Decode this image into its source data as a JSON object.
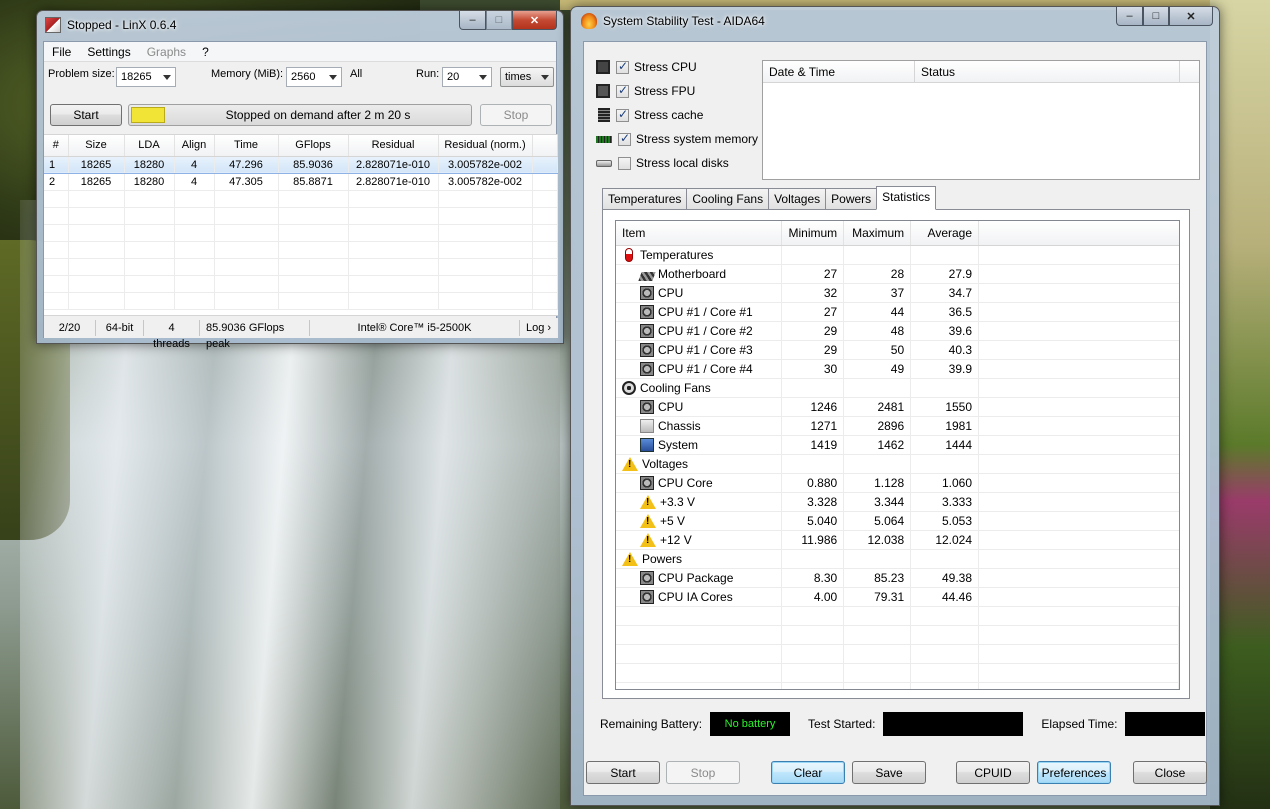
{
  "linx": {
    "title": "Stopped - LinX 0.6.4",
    "menu": [
      "File",
      "Settings",
      "Graphs",
      "?"
    ],
    "problem_size_label": "Problem size:",
    "problem_size_value": "18265",
    "memory_label": "Memory (MiB):",
    "memory_value": "2560",
    "all_label": "All",
    "run_label": "Run:",
    "run_value": "20",
    "run_unit": "times",
    "start_label": "Start",
    "status_message": "Stopped on demand after 2 m 20 s",
    "stop_label": "Stop",
    "status_color": "#f2e437",
    "table": {
      "headers": [
        "#",
        "Size",
        "LDA",
        "Align",
        "Time",
        "GFlops",
        "Residual",
        "Residual (norm.)"
      ],
      "rows": [
        [
          "1",
          "18265",
          "18280",
          "4",
          "47.296",
          "85.9036",
          "2.828071e-010",
          "3.005782e-002"
        ],
        [
          "2",
          "18265",
          "18280",
          "4",
          "47.305",
          "85.8871",
          "2.828071e-010",
          "3.005782e-002"
        ]
      ]
    },
    "statusbar": {
      "progress": "2/20",
      "bits": "64-bit",
      "threads": "4 threads",
      "peak": "85.9036 GFlops peak",
      "cpu": "Intel® Core™ i5-2500K",
      "log": "Log ›"
    }
  },
  "aida": {
    "title": "System Stability Test - AIDA64",
    "stress": [
      {
        "label": "Stress CPU",
        "checked": true,
        "icon": "cpu-icon"
      },
      {
        "label": "Stress FPU",
        "checked": true,
        "icon": "fpu-icon"
      },
      {
        "label": "Stress cache",
        "checked": true,
        "icon": "cache-icon"
      },
      {
        "label": "Stress system memory",
        "checked": true,
        "icon": "memory-icon"
      },
      {
        "label": "Stress local disks",
        "checked": false,
        "icon": "disk-icon"
      }
    ],
    "log_headers": [
      "Date & Time",
      "Status"
    ],
    "tabs": [
      "Temperatures",
      "Cooling Fans",
      "Voltages",
      "Powers",
      "Statistics"
    ],
    "active_tab": "Statistics",
    "stats_headers": [
      "Item",
      "Minimum",
      "Maximum",
      "Average"
    ],
    "stats": [
      {
        "group": true,
        "icon": "thermometer-icon",
        "label": "Temperatures"
      },
      {
        "icon": "motherboard-icon",
        "label": "Motherboard",
        "min": "27",
        "max": "28",
        "avg": "27.9"
      },
      {
        "icon": "cpu-chip-icon",
        "label": "CPU",
        "min": "32",
        "max": "37",
        "avg": "34.7"
      },
      {
        "icon": "cpu-chip-icon",
        "label": "CPU #1 / Core #1",
        "min": "27",
        "max": "44",
        "avg": "36.5"
      },
      {
        "icon": "cpu-chip-icon",
        "label": "CPU #1 / Core #2",
        "min": "29",
        "max": "48",
        "avg": "39.6"
      },
      {
        "icon": "cpu-chip-icon",
        "label": "CPU #1 / Core #3",
        "min": "29",
        "max": "50",
        "avg": "40.3"
      },
      {
        "icon": "cpu-chip-icon",
        "label": "CPU #1 / Core #4",
        "min": "30",
        "max": "49",
        "avg": "39.9"
      },
      {
        "group": true,
        "icon": "fan-icon",
        "label": "Cooling Fans"
      },
      {
        "icon": "cpu-chip-icon",
        "label": "CPU",
        "min": "1246",
        "max": "2481",
        "avg": "1550"
      },
      {
        "icon": "chassis-icon",
        "label": "Chassis",
        "min": "1271",
        "max": "2896",
        "avg": "1981"
      },
      {
        "icon": "system-icon",
        "label": "System",
        "min": "1419",
        "max": "1462",
        "avg": "1444"
      },
      {
        "group": true,
        "icon": "warning-icon",
        "label": "Voltages"
      },
      {
        "icon": "cpu-chip-icon",
        "label": "CPU Core",
        "min": "0.880",
        "max": "1.128",
        "avg": "1.060"
      },
      {
        "icon": "warning-icon",
        "label": "+3.3 V",
        "min": "3.328",
        "max": "3.344",
        "avg": "3.333"
      },
      {
        "icon": "warning-icon",
        "label": "+5 V",
        "min": "5.040",
        "max": "5.064",
        "avg": "5.053"
      },
      {
        "icon": "warning-icon",
        "label": "+12 V",
        "min": "11.986",
        "max": "12.038",
        "avg": "12.024"
      },
      {
        "group": true,
        "icon": "warning-icon",
        "label": "Powers"
      },
      {
        "icon": "cpu-chip-icon",
        "label": "CPU Package",
        "min": "8.30",
        "max": "85.23",
        "avg": "49.38"
      },
      {
        "icon": "cpu-chip-icon",
        "label": "CPU IA Cores",
        "min": "4.00",
        "max": "79.31",
        "avg": "44.46"
      }
    ],
    "remaining_battery_label": "Remaining Battery:",
    "remaining_battery_value": "No battery",
    "test_started_label": "Test Started:",
    "elapsed_label": "Elapsed Time:",
    "buttons": {
      "start": "Start",
      "stop": "Stop",
      "clear": "Clear",
      "save": "Save",
      "cpuid": "CPUID",
      "preferences": "Preferences",
      "close": "Close"
    }
  }
}
